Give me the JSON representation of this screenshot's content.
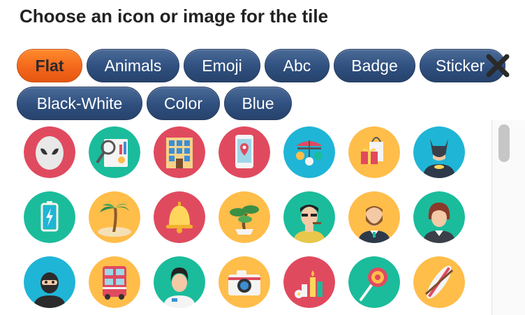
{
  "title": "Choose an icon or image for the tile",
  "tabs": [
    {
      "label": "Flat",
      "active": true
    },
    {
      "label": "Animals",
      "active": false
    },
    {
      "label": "Emoji",
      "active": false
    },
    {
      "label": "Abc",
      "active": false
    },
    {
      "label": "Badge",
      "active": false
    },
    {
      "label": "Sticker",
      "active": false
    },
    {
      "label": "Black-White",
      "active": false
    },
    {
      "label": "Color",
      "active": false
    },
    {
      "label": "Blue",
      "active": false
    }
  ],
  "close_icon": "close-icon",
  "icons": [
    {
      "name": "alien-icon",
      "color": "#e04a5f"
    },
    {
      "name": "analytics-magnifier-icon",
      "color": "#1bbc9b"
    },
    {
      "name": "building-icon",
      "color": "#e04a5f"
    },
    {
      "name": "map-phone-icon",
      "color": "#e04a5f"
    },
    {
      "name": "carousel-icon",
      "color": "#1fb5d6"
    },
    {
      "name": "shopping-bag-gift-icon",
      "color": "#ffbd4a"
    },
    {
      "name": "batman-icon",
      "color": "#1fb5d6"
    },
    {
      "name": "battery-icon",
      "color": "#1bbc9b"
    },
    {
      "name": "palm-island-icon",
      "color": "#ffbd4a"
    },
    {
      "name": "bell-icon",
      "color": "#e04a5f"
    },
    {
      "name": "bonsai-icon",
      "color": "#ffbd4a"
    },
    {
      "name": "mobster-icon",
      "color": "#1bbc9b"
    },
    {
      "name": "bearded-businessman-icon",
      "color": "#ffbd4a"
    },
    {
      "name": "businesswoman-icon",
      "color": "#1bbc9b"
    },
    {
      "name": "burglar-icon",
      "color": "#1fb5d6"
    },
    {
      "name": "double-decker-bus-icon",
      "color": "#ffbd4a"
    },
    {
      "name": "nurse-icon",
      "color": "#1bbc9b"
    },
    {
      "name": "camera-icon",
      "color": "#ffbd4a"
    },
    {
      "name": "candles-icon",
      "color": "#e04a5f"
    },
    {
      "name": "lollipop-icon",
      "color": "#1bbc9b"
    },
    {
      "name": "surfboard-icon",
      "color": "#ffbd4a"
    }
  ]
}
